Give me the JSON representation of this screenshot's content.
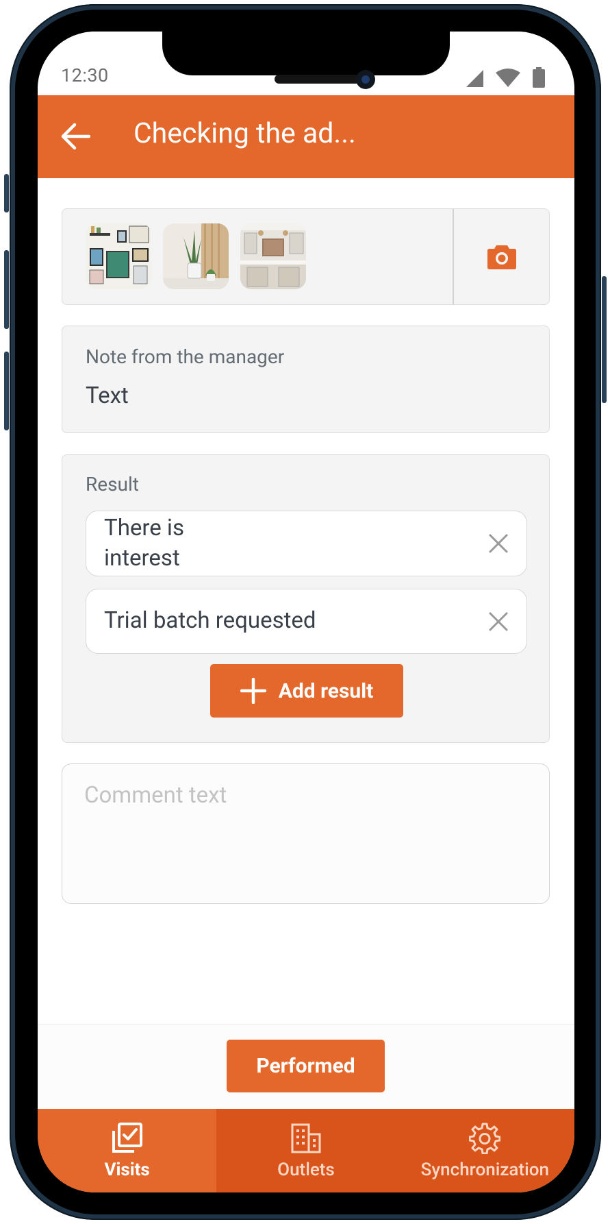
{
  "status_bar": {
    "time": "12:30"
  },
  "app_bar": {
    "title": "Checking the ad..."
  },
  "photos": {
    "count": 3
  },
  "note": {
    "label": "Note from the manager",
    "text": "Text"
  },
  "result": {
    "label": "Result",
    "chips": [
      {
        "label": "There is interest"
      },
      {
        "label": "Trial batch requested"
      }
    ],
    "add_button_label": "Add result"
  },
  "comment": {
    "placeholder": "Comment text"
  },
  "action": {
    "performed_label": "Performed"
  },
  "bottom_nav": {
    "items": [
      {
        "label": "Visits",
        "icon": "visits-check-icon",
        "active": true
      },
      {
        "label": "Outlets",
        "icon": "building-icon",
        "active": false
      },
      {
        "label": "Synchronization",
        "icon": "gear-icon",
        "active": false
      }
    ]
  },
  "colors": {
    "accent": "#e4682b",
    "nav_bg": "#d9541b",
    "card_bg": "#f4f4f4"
  }
}
